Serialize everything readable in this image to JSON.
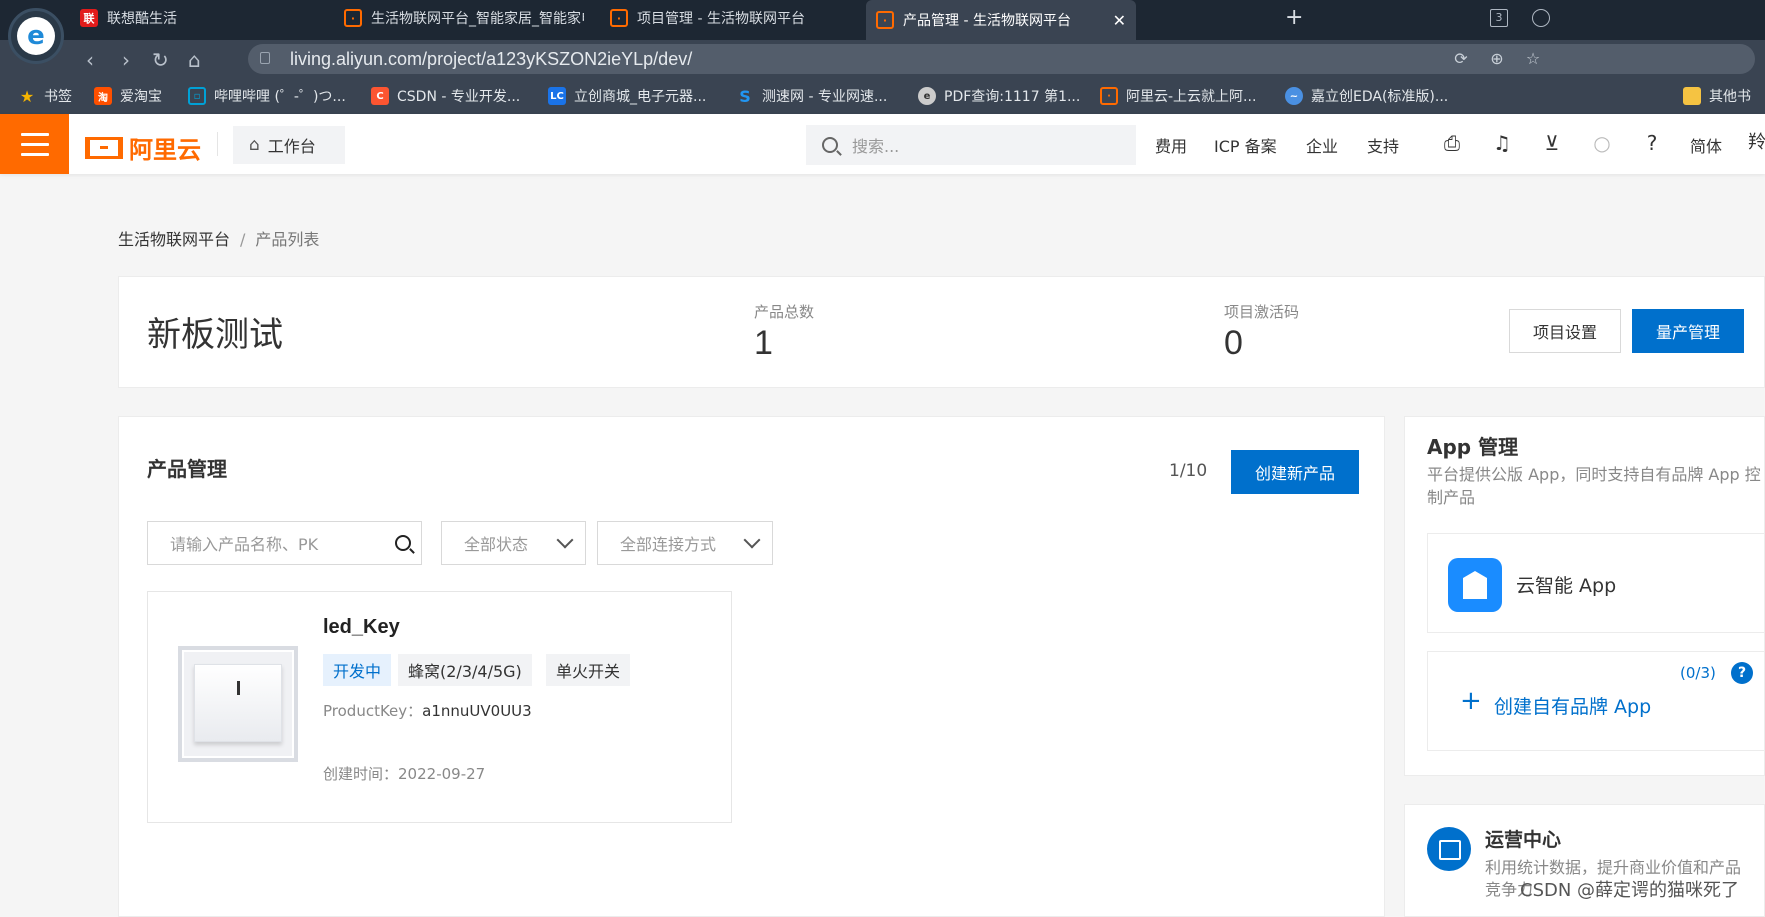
{
  "browser": {
    "tabs": [
      {
        "label": "联想酷生活",
        "favicon": "lenovo-icon",
        "color": "#e21b1b"
      },
      {
        "label": "生活物联网平台_智能家居_智能家电",
        "favicon": "aliyun-icon",
        "color": "#ff6a00"
      },
      {
        "label": "项目管理 - 生活物联网平台",
        "favicon": "aliyun-icon",
        "color": "#ff6a00"
      },
      {
        "label": "产品管理 - 生活物联网平台",
        "favicon": "aliyun-icon",
        "color": "#ff6a00",
        "active": true
      }
    ],
    "tab_badge": "3",
    "url": "living.aliyun.com/project/a123yKSZON2ieYLp/dev/",
    "bookmarks": [
      {
        "label": "书签",
        "icon": "star-icon",
        "color": "#f5b400"
      },
      {
        "label": "爱淘宝",
        "icon": "taobao-icon",
        "color": "#ff5000"
      },
      {
        "label": "哔哩哔哩 (゜-゜)つ...",
        "icon": "bilibili-icon",
        "color": "#00a1d6"
      },
      {
        "label": "CSDN - 专业开发...",
        "icon": "csdn-icon",
        "color": "#fc5531"
      },
      {
        "label": "立创商城_电子元器...",
        "icon": "lc-icon",
        "color": "#1a73e8"
      },
      {
        "label": "测速网 - 专业网速...",
        "icon": "speedtest-icon",
        "color": "#2196f3"
      },
      {
        "label": "PDF查询:1117 第1...",
        "icon": "pdf-icon",
        "color": "#cccccc"
      },
      {
        "label": "阿里云-上云就上阿...",
        "icon": "aliyun-icon",
        "color": "#ff6a00"
      },
      {
        "label": "嘉立创EDA(标准版)...",
        "icon": "eda-icon",
        "color": "#4a90e2"
      },
      {
        "label": "其他书",
        "icon": "folder-icon",
        "color": "#f5c342"
      }
    ]
  },
  "header": {
    "logo": "阿里云",
    "workbench": "工作台",
    "search_placeholder": "搜索...",
    "links": [
      "费用",
      "ICP 备案",
      "企业",
      "支持"
    ],
    "lang": "简体",
    "edge_glyph": "羚"
  },
  "breadcrumb": {
    "root": "生活物联网平台",
    "separator": "/",
    "current": "产品列表"
  },
  "summary": {
    "project_name": "新板测试",
    "product_total_label": "产品总数",
    "product_total": "1",
    "activation_label": "项目激活码",
    "activation_count": "0",
    "settings_button": "项目设置",
    "mass_production_button": "量产管理"
  },
  "products": {
    "title": "产品管理",
    "page_count": "1/10",
    "create_button": "创建新产品",
    "search_placeholder": "请输入产品名称、PK",
    "status_filter": "全部状态",
    "connection_filter": "全部连接方式",
    "items": [
      {
        "name": "led_Key",
        "tags": [
          "开发中",
          "蜂窝(2/3/4/5G)",
          "单火开关"
        ],
        "product_key_label": "ProductKey：",
        "product_key": "a1nnuUV0UU3",
        "created_label": "创建时间：",
        "created": "2022-09-27"
      }
    ]
  },
  "app_panel": {
    "title": "App 管理",
    "description": "平台提供公版 App，同时支持自有品牌 App 控制产品",
    "app_name": "云智能 App",
    "create_label": "创建自有品牌 App",
    "quota": "(0/3)",
    "help": "?"
  },
  "ops_panel": {
    "title": "运营中心",
    "description": "利用统计数据，提升商业价值和产品竞争力"
  },
  "watermark": "CSDN @薛定谔的猫咪死了",
  "colors": {
    "brand": "#ff6a00",
    "primary": "#0070cc"
  }
}
